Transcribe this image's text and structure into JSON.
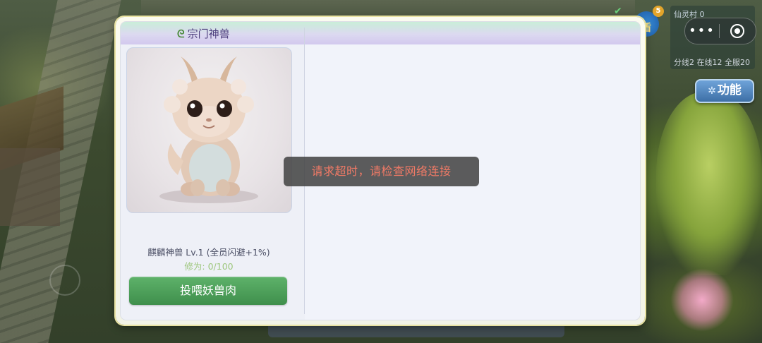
{
  "hud": {
    "village": "仙灵村",
    "village_count": "0",
    "online_status": "分线2 在线12 全服20",
    "mail_badge": "5",
    "shield_label": "盾",
    "function_button": "功能"
  },
  "dialog": {
    "title": "宗门神兽",
    "pet_name": "麒麟神兽 Lv.1 (全员闪避+1%)",
    "cultivation": "修为: 0/100",
    "feed_button": "投喂妖兽肉"
  },
  "toast": {
    "message": "请求超时，请检查网络连接"
  },
  "colors": {
    "feed_button": "#4a9f57",
    "toast_text": "#f07a66",
    "title_text": "#4e3f7e",
    "exp_text": "#9ec77e"
  },
  "icons": [
    "dragon-icon",
    "more-icon",
    "close-icon",
    "shield-icon",
    "check-icon",
    "pet-portrait"
  ]
}
